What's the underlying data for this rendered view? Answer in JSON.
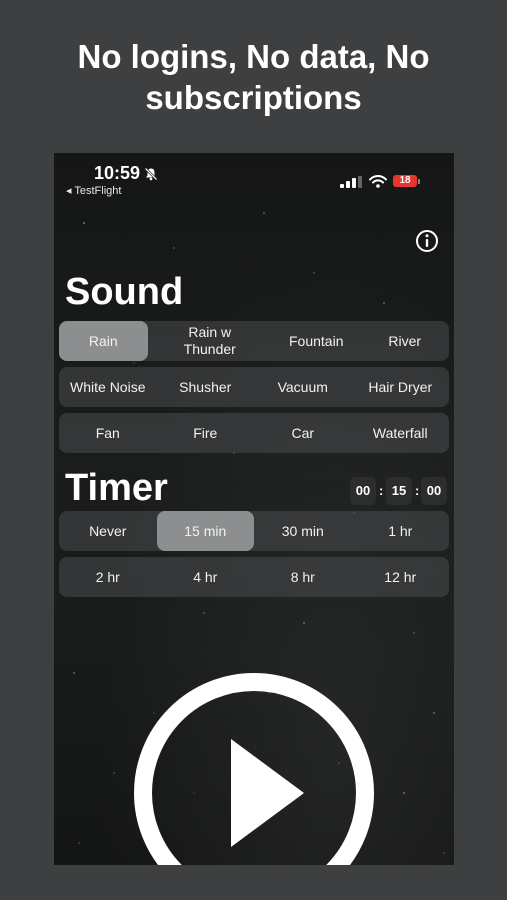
{
  "headline": "No logins, No data, No subscriptions",
  "status": {
    "time": "10:59",
    "back_label": "◂ TestFlight",
    "battery": "18"
  },
  "sound": {
    "title": "Sound",
    "rows": [
      [
        "Rain",
        "Rain w Thunder",
        "Fountain",
        "River"
      ],
      [
        "White Noise",
        "Shusher",
        "Vacuum",
        "Hair Dryer"
      ],
      [
        "Fan",
        "Fire",
        "Car",
        "Waterfall"
      ]
    ],
    "selected": "Rain"
  },
  "timer": {
    "title": "Timer",
    "hours": "00",
    "minutes": "15",
    "seconds": "00",
    "rows": [
      [
        "Never",
        "15 min",
        "30 min",
        "1 hr"
      ],
      [
        "2 hr",
        "4 hr",
        "8 hr",
        "12 hr"
      ]
    ],
    "selected": "15 min"
  },
  "icons": {
    "info": "info-icon",
    "play": "play-icon",
    "bell": "bell-slash-icon"
  },
  "colors": {
    "background": "#3e3f41",
    "selected_segment": "#8c8e90",
    "battery": "#e5372f"
  }
}
